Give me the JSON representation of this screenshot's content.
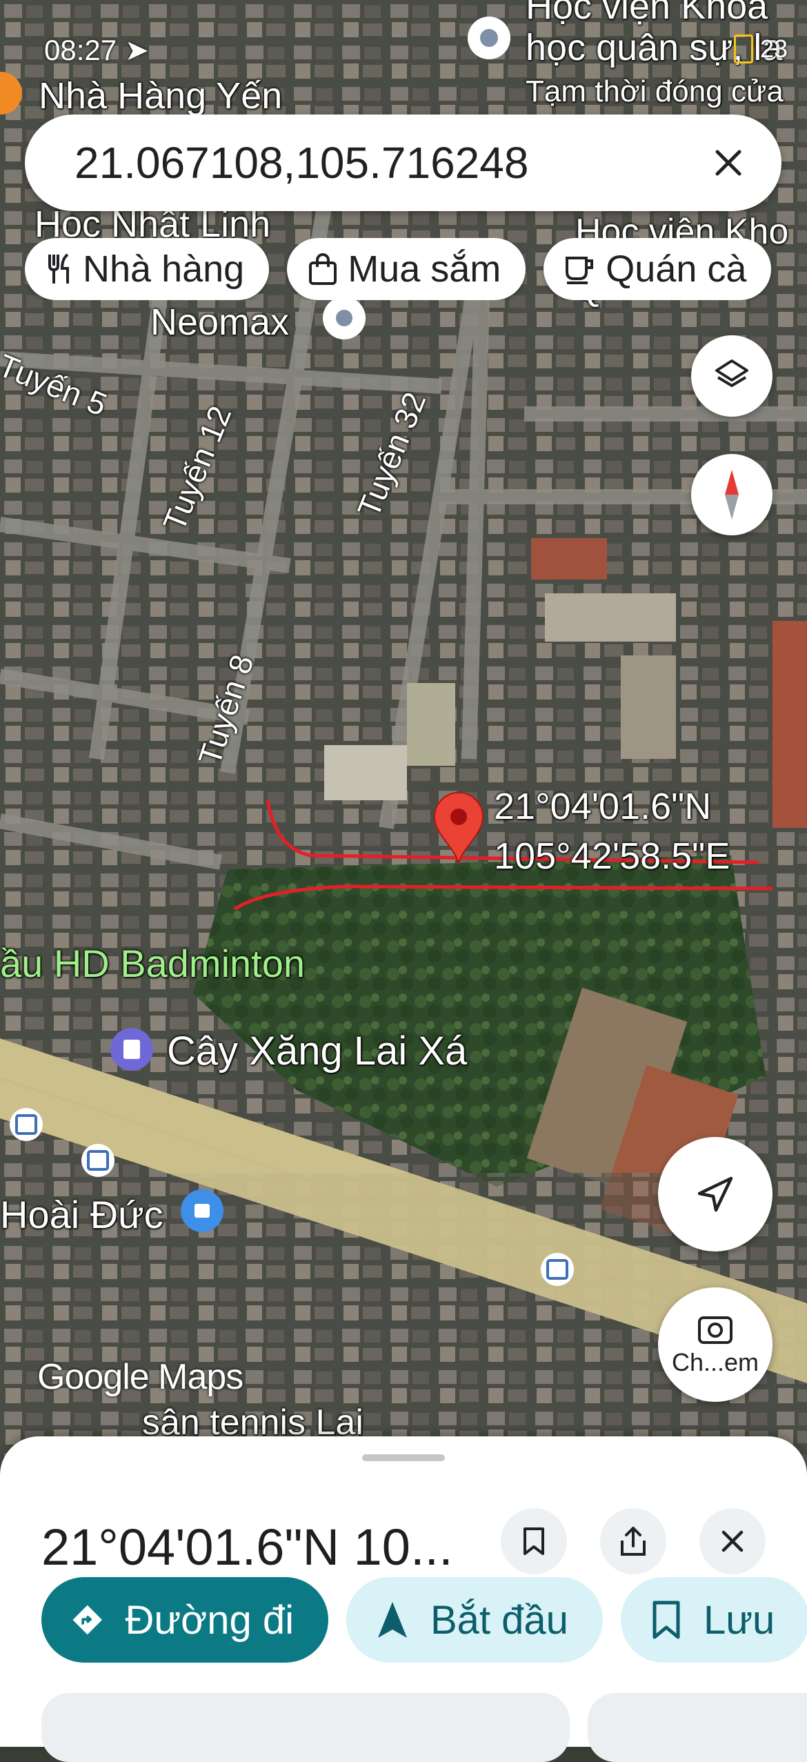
{
  "status_bar": {
    "time": "08:27",
    "right_text": "23"
  },
  "search": {
    "value": "21.067108,105.716248",
    "clear_icon": "close-icon"
  },
  "chips": [
    {
      "label": "Nhà hàng",
      "icon": "restaurant-icon"
    },
    {
      "label": "Mua sắm",
      "icon": "shopping-bag-icon"
    },
    {
      "label": "Quán cà",
      "icon": "coffee-icon"
    }
  ],
  "map": {
    "labels": {
      "top_poi_1": "Học viện Khoa",
      "top_poi_2": "học quân sự, la",
      "top_poi_status": "Tạm thời đóng cửa",
      "restaurant": "Nhà Hàng Yến",
      "school": "Học Nhật Linh",
      "hocvien_right": "Học viện Kho",
      "hocvien_right2": "Q",
      "neomax": "Neomax",
      "tuyen5": "Tuyến 5",
      "tuyen12": "Tuyến 12",
      "tuyen32": "Tuyến 32",
      "tuyen8": "Tuyến 8",
      "pin_lat": "21°04'01.6\"N",
      "pin_lng": "105°42'58.5\"E",
      "badminton": "ầu HD Badminton",
      "gas_station": "Cây Xăng Lai Xá",
      "hoai_duc": "Hoài Đức",
      "tennis": "sân tennis Lai"
    },
    "watermark": "Google Maps",
    "layers_icon": "layers-icon",
    "compass_icon": "compass-icon",
    "location_icon": "my-location-icon",
    "camera_label": "Ch...em"
  },
  "sheet": {
    "title": "21°04'01.6\"N 10...",
    "actions": [
      {
        "label": "Đường đi",
        "icon": "directions-icon"
      },
      {
        "label": "Bắt đầu",
        "icon": "navigation-arrow-icon"
      },
      {
        "label": "Lưu",
        "icon": "bookmark-icon"
      }
    ]
  },
  "colors": {
    "accent": "#0b7a85",
    "tonal": "#d9f2f7",
    "pin": "#ea4335",
    "highlight_line": "#e3202a"
  }
}
